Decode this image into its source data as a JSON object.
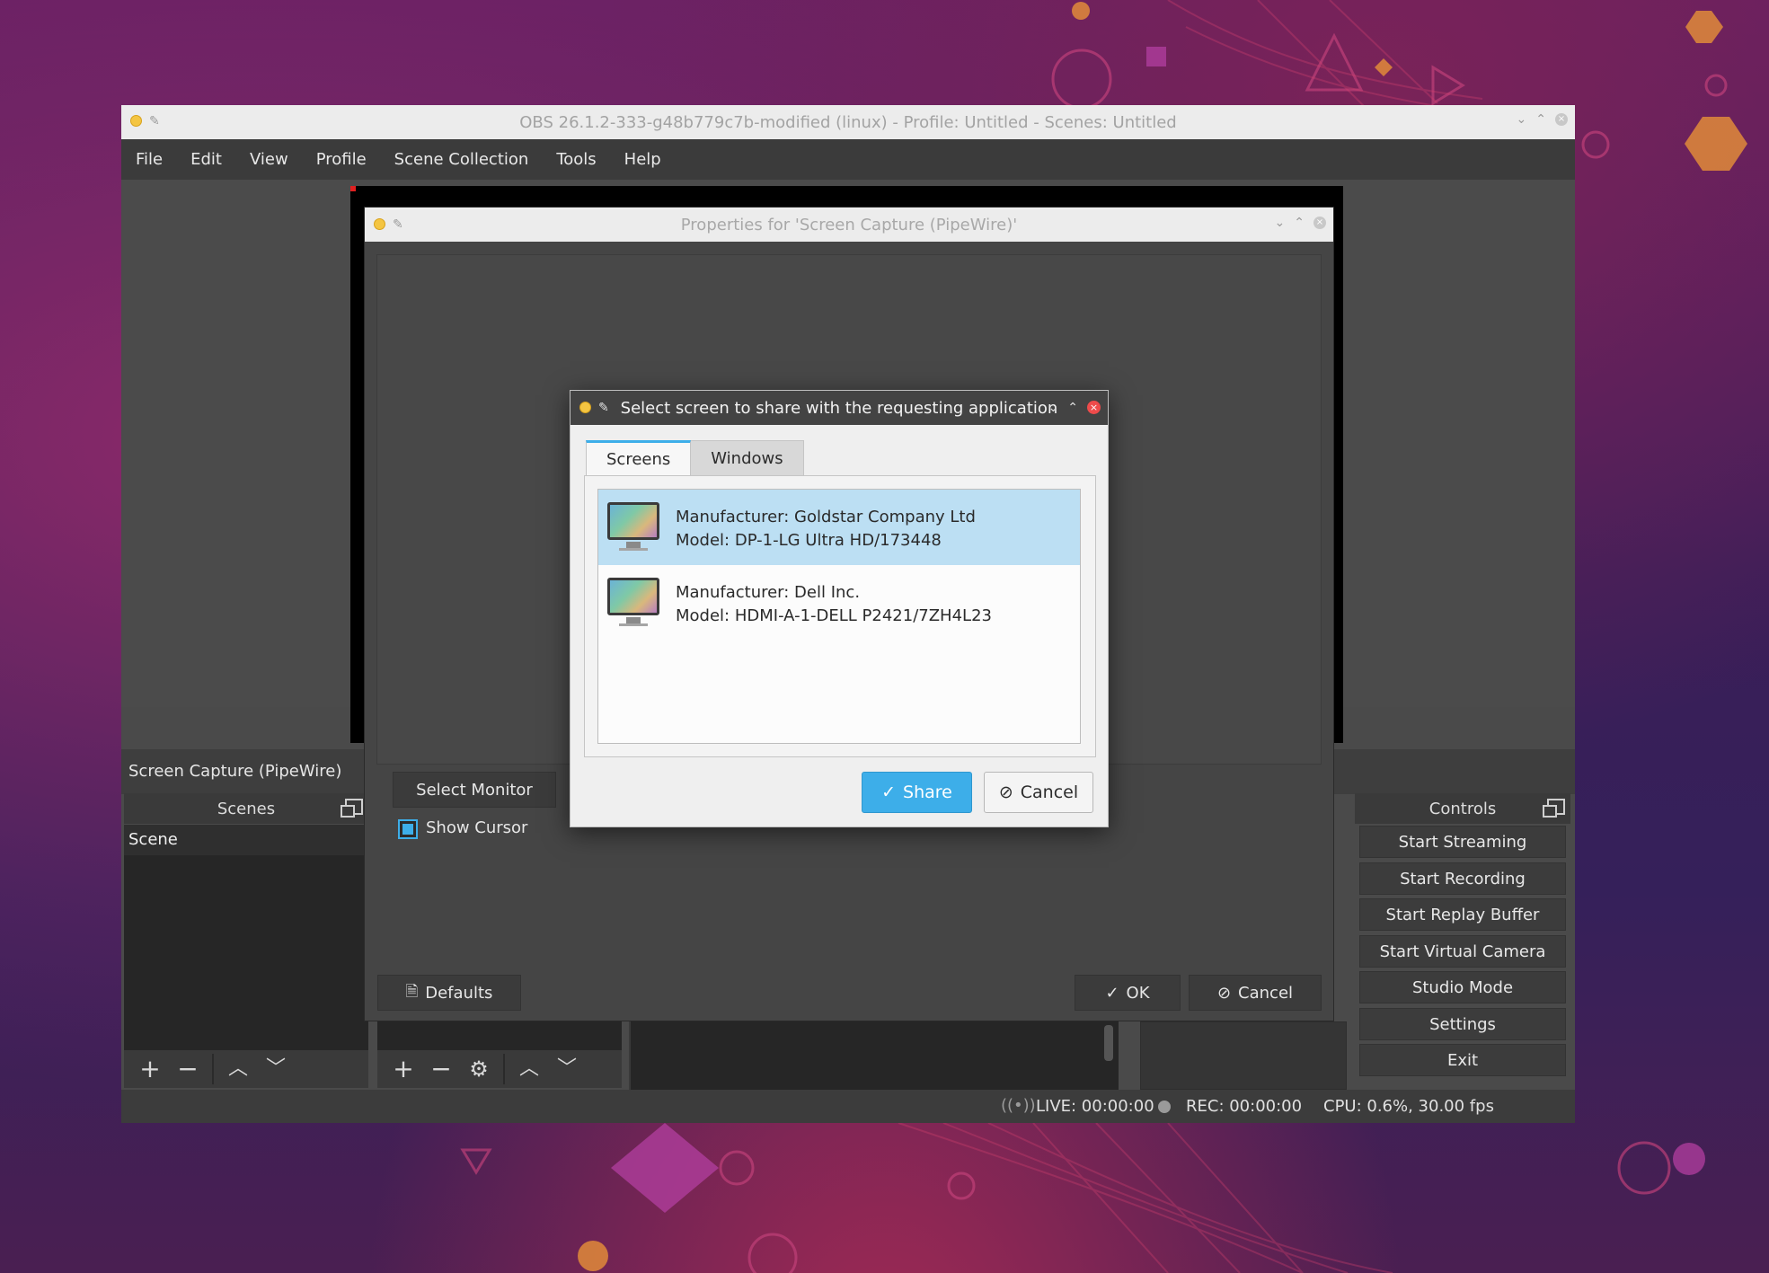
{
  "main_window": {
    "title": "OBS 26.1.2-333-g48b779c7b-modified (linux) - Profile: Untitled - Scenes: Untitled",
    "menu": [
      "File",
      "Edit",
      "View",
      "Profile",
      "Scene Collection",
      "Tools",
      "Help"
    ],
    "source_name": "Screen Capture (PipeWire)",
    "scenes_dock": {
      "title": "Scenes",
      "items": [
        "Scene"
      ]
    },
    "controls_dock": {
      "title": "Controls",
      "buttons": [
        "Start Streaming",
        "Start Recording",
        "Start Replay Buffer",
        "Start Virtual Camera",
        "Studio Mode",
        "Settings",
        "Exit"
      ]
    },
    "status": {
      "live": "LIVE: 00:00:00",
      "rec": "REC: 00:00:00",
      "cpu": "CPU: 0.6%, 30.00 fps"
    }
  },
  "properties_dialog": {
    "title": "Properties for 'Screen Capture (PipeWire)'",
    "select_monitor_label": "Select Monitor",
    "show_cursor_label": "Show Cursor",
    "show_cursor_checked": true,
    "defaults_label": "Defaults",
    "ok_label": "OK",
    "cancel_label": "Cancel"
  },
  "portal_dialog": {
    "title": "Select screen to share with the requesting application",
    "tabs": [
      "Screens",
      "Windows"
    ],
    "active_tab": "Screens",
    "screens": [
      {
        "manufacturer": "Manufacturer: Goldstar Company Ltd",
        "model": "Model: DP-1-LG Ultra HD/173448",
        "selected": true
      },
      {
        "manufacturer": "Manufacturer: Dell Inc.",
        "model": "Model: HDMI-A-1-DELL P2421/7ZH4L23",
        "selected": false
      }
    ],
    "share_label": "Share",
    "cancel_label": "Cancel"
  },
  "colors": {
    "accent": "#3daee9",
    "selection": "#bcdff3",
    "window_bg": "#4a4a4a"
  }
}
